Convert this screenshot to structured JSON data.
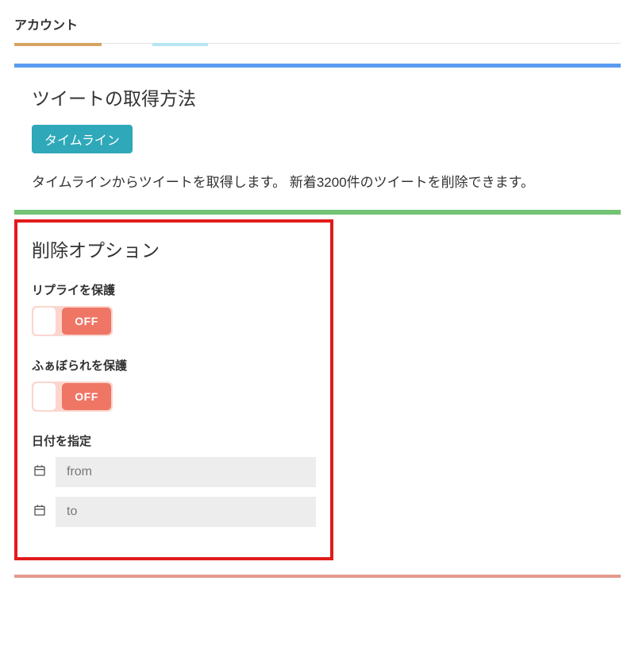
{
  "account": {
    "label": "アカウント"
  },
  "tweetFetch": {
    "title": "ツイートの取得方法",
    "chip": "タイムライン",
    "description": "タイムラインからツイートを取得します。 新着3200件のツイートを削除できます。"
  },
  "deleteOptions": {
    "title": "削除オプション",
    "protectReplies": {
      "label": "リプライを保護",
      "state": "OFF"
    },
    "protectFavorited": {
      "label": "ふぁぼられを保護",
      "state": "OFF"
    },
    "dateSpecify": {
      "label": "日付を指定",
      "fromPlaceholder": "from",
      "toPlaceholder": "to"
    }
  }
}
